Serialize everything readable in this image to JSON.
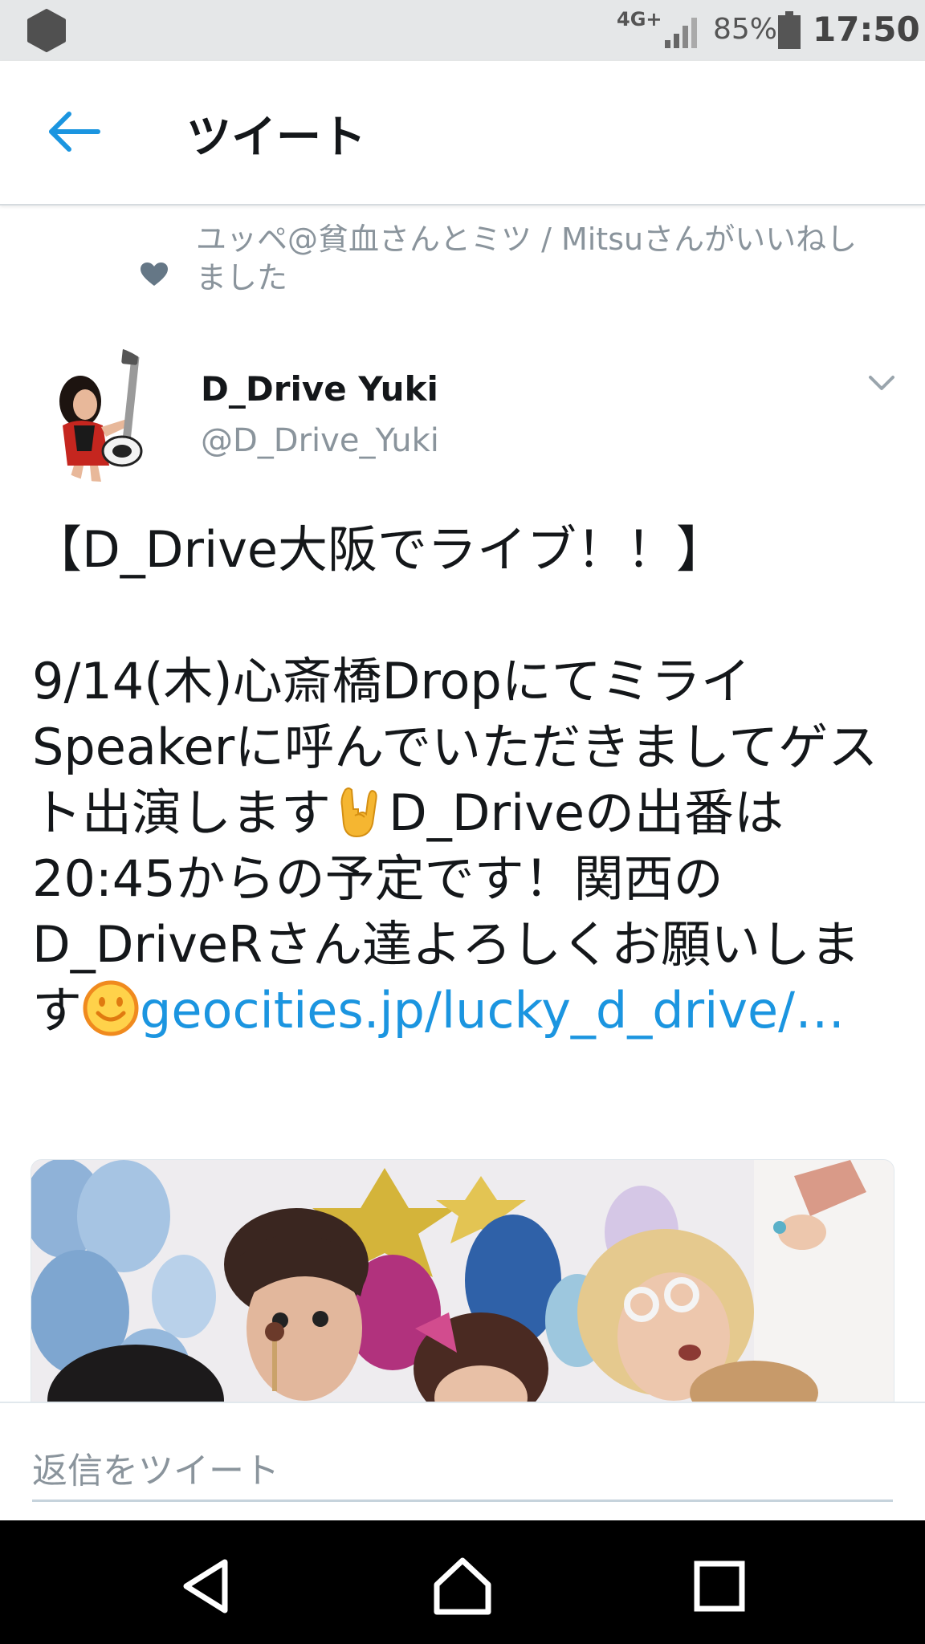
{
  "status_bar": {
    "network": "4G+",
    "battery_percent": "85%",
    "time": "17:50"
  },
  "header": {
    "title": "ツイート"
  },
  "social_context": {
    "text": "ユッペ@貧血さんとミツ / Mitsuさんがいいねしました"
  },
  "author": {
    "name": "D_Drive Yuki",
    "handle": "@D_Drive_Yuki"
  },
  "tweet": {
    "line1": "【D_Drive大阪でライブ！！】",
    "line2a": "9/14(木)心斎橋DropにてミライSpeakerに呼んでいただきましてゲスト出演します",
    "emoji1": "rock-hand-emoji",
    "line2b": "D_Driveの出番は20:45からの予定です！関西のD_DriveRさん達よろしくお願いします",
    "emoji2": "smiley-emoji",
    "link": "geocities.jp/lucky_d_drive/…"
  },
  "reply": {
    "placeholder": "返信をツイート"
  },
  "colors": {
    "accent": "#1b95e0",
    "secondary_text": "#8a949c"
  }
}
